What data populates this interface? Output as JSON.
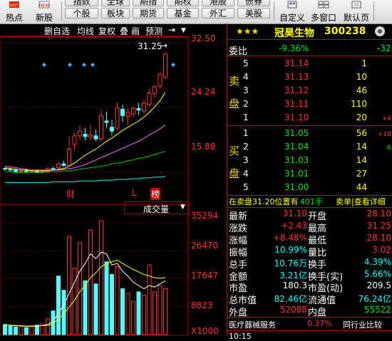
{
  "toolbar": {
    "left_buttons": [
      {
        "label": "热点"
      },
      {
        "label": "新股"
      }
    ],
    "seg_top": [
      "指数",
      "全球",
      "期指",
      "期权",
      "港股",
      "债券"
    ],
    "seg_bottom": [
      "个股",
      "板块",
      "期货",
      "基金",
      "外汇",
      "美股"
    ],
    "right_buttons": [
      {
        "label": "自定义"
      },
      {
        "label": "多窗口"
      },
      {
        "label": "默认页"
      }
    ]
  },
  "kchart": {
    "tabs": [
      "删自选",
      "均线",
      "复权",
      "叠",
      "画",
      "预测"
    ],
    "price_axis": [
      "32.50",
      "24.24",
      "15.88"
    ],
    "high_label": "31.25",
    "event_markers": [
      {
        "label": "财",
        "color": "#ff3232"
      },
      {
        "label": "L",
        "color": "#ff3232"
      },
      {
        "label": "榜",
        "color": "#ffffff",
        "bg": "#c00000"
      }
    ],
    "volume_dropdown": "成交量",
    "volume_axis": [
      "35294",
      "26470",
      "17647",
      "8823",
      "X1000"
    ]
  },
  "chart_data": {
    "type": "candlestick",
    "ylim": [
      14,
      33
    ],
    "candles": [
      {
        "o": 16.4,
        "h": 16.6,
        "l": 16.1,
        "c": 16.3
      },
      {
        "o": 16.3,
        "h": 16.5,
        "l": 16.0,
        "c": 16.2
      },
      {
        "o": 16.2,
        "h": 16.4,
        "l": 15.9,
        "c": 16.0
      },
      {
        "o": 16.0,
        "h": 16.3,
        "l": 15.8,
        "c": 16.1
      },
      {
        "o": 16.1,
        "h": 16.4,
        "l": 15.9,
        "c": 16.0
      },
      {
        "o": 16.0,
        "h": 16.2,
        "l": 15.9,
        "c": 16.1
      },
      {
        "o": 16.1,
        "h": 16.3,
        "l": 15.8,
        "c": 15.9
      },
      {
        "o": 15.9,
        "h": 16.2,
        "l": 15.7,
        "c": 16.0
      },
      {
        "o": 16.0,
        "h": 16.5,
        "l": 15.8,
        "c": 16.4
      },
      {
        "o": 16.4,
        "h": 16.6,
        "l": 16.1,
        "c": 16.2
      },
      {
        "o": 16.5,
        "h": 17.2,
        "l": 16.3,
        "c": 17.0
      },
      {
        "o": 17.0,
        "h": 17.4,
        "l": 16.6,
        "c": 16.8
      },
      {
        "o": 16.8,
        "h": 20.5,
        "l": 16.7,
        "c": 18.9
      },
      {
        "o": 19.5,
        "h": 21.0,
        "l": 18.8,
        "c": 20.6
      },
      {
        "o": 20.6,
        "h": 22.0,
        "l": 20.1,
        "c": 21.2
      },
      {
        "o": 20.8,
        "h": 21.6,
        "l": 20.0,
        "c": 20.5
      },
      {
        "o": 20.4,
        "h": 22.0,
        "l": 20.0,
        "c": 20.7
      },
      {
        "o": 20.6,
        "h": 21.4,
        "l": 19.9,
        "c": 20.2
      },
      {
        "o": 20.2,
        "h": 23.9,
        "l": 19.9,
        "c": 23.2
      },
      {
        "o": 22.5,
        "h": 23.7,
        "l": 21.6,
        "c": 22.3
      },
      {
        "o": 21.7,
        "h": 22.7,
        "l": 20.6,
        "c": 21.2
      },
      {
        "o": 21.6,
        "h": 24.9,
        "l": 21.3,
        "c": 24.2
      },
      {
        "o": 24.0,
        "h": 24.6,
        "l": 22.4,
        "c": 23.2
      },
      {
        "o": 23.1,
        "h": 24.1,
        "l": 22.0,
        "c": 23.6
      },
      {
        "o": 23.4,
        "h": 24.4,
        "l": 23.0,
        "c": 24.1
      },
      {
        "o": 24.1,
        "h": 24.8,
        "l": 23.3,
        "c": 23.9
      },
      {
        "o": 23.8,
        "h": 25.2,
        "l": 23.4,
        "c": 24.8
      },
      {
        "o": 24.6,
        "h": 26.6,
        "l": 24.4,
        "c": 26.1
      },
      {
        "o": 26.0,
        "h": 27.1,
        "l": 25.5,
        "c": 26.9
      },
      {
        "o": 27.0,
        "h": 28.8,
        "l": 26.7,
        "c": 28.5
      },
      {
        "o": 28.1,
        "h": 31.25,
        "l": 28.0,
        "c": 31.1
      }
    ],
    "ma_lines": [
      {
        "color": "#ffff00",
        "values": [
          16.5,
          16.4,
          16.3,
          16.2,
          16.2,
          16.1,
          16.1,
          16.1,
          16.1,
          16.2,
          16.3,
          16.4,
          16.7,
          17.1,
          17.6,
          18.1,
          18.5,
          18.9,
          19.4,
          19.9,
          20.3,
          20.8,
          21.3,
          21.7,
          22.1,
          22.5,
          23.0,
          23.6,
          24.3,
          25.1,
          26.2
        ]
      },
      {
        "color": "#ff66ff",
        "values": [
          16.7,
          16.6,
          16.5,
          16.4,
          16.3,
          16.2,
          16.2,
          16.2,
          16.2,
          16.2,
          16.2,
          16.3,
          16.4,
          16.5,
          16.7,
          16.9,
          17.2,
          17.5,
          17.8,
          18.1,
          18.4,
          18.7,
          19.0,
          19.3,
          19.6,
          19.9,
          20.3,
          20.7,
          21.1,
          21.5,
          22.0
        ]
      },
      {
        "color": "#00d000",
        "values": [
          16.0,
          16.0,
          15.9,
          15.9,
          15.9,
          15.9,
          15.9,
          15.9,
          16.0,
          16.0,
          16.0,
          16.1,
          16.1,
          16.2,
          16.3,
          16.4,
          16.5,
          16.6,
          16.7,
          16.8,
          17.0,
          17.1,
          17.2,
          17.4,
          17.5,
          17.7,
          17.8,
          18.0,
          18.2,
          18.4,
          18.6
        ]
      },
      {
        "color": "#00ffff",
        "values": [
          14.6,
          14.6,
          14.6,
          14.6,
          14.6,
          14.6,
          14.6,
          14.6,
          14.6,
          14.7,
          14.7,
          14.7,
          14.7,
          14.7,
          14.8,
          14.8,
          14.8,
          14.8,
          14.9,
          14.9,
          14.9,
          15.0,
          15.0,
          15.0,
          15.1,
          15.1,
          15.2,
          15.2,
          15.3,
          15.3,
          15.4
        ]
      }
    ],
    "volume": {
      "ylim": [
        0,
        38000
      ],
      "bars": [
        {
          "v": 3200,
          "up": false
        },
        {
          "v": 2600,
          "up": false
        },
        {
          "v": 2400,
          "up": false
        },
        {
          "v": 2800,
          "up": true
        },
        {
          "v": 2200,
          "up": false
        },
        {
          "v": 2500,
          "up": true
        },
        {
          "v": 3000,
          "up": false
        },
        {
          "v": 3300,
          "up": true
        },
        {
          "v": 5000,
          "up": true
        },
        {
          "v": 7500,
          "up": false
        },
        {
          "v": 18500,
          "up": false
        },
        {
          "v": 14000,
          "up": false
        },
        {
          "v": 31000,
          "up": true
        },
        {
          "v": 21000,
          "up": true
        },
        {
          "v": 29000,
          "up": true
        },
        {
          "v": 17000,
          "up": false
        },
        {
          "v": 33000,
          "up": true
        },
        {
          "v": 16000,
          "up": false
        },
        {
          "v": 36000,
          "up": true
        },
        {
          "v": 23000,
          "up": false
        },
        {
          "v": 19000,
          "up": false
        },
        {
          "v": 21500,
          "up": true
        },
        {
          "v": 14500,
          "up": false
        },
        {
          "v": 13000,
          "up": true
        },
        {
          "v": 10500,
          "up": true
        },
        {
          "v": 13500,
          "up": false
        },
        {
          "v": 12500,
          "up": true
        },
        {
          "v": 22000,
          "up": true
        },
        {
          "v": 13500,
          "up": true
        },
        {
          "v": 15500,
          "up": true
        },
        {
          "v": 14500,
          "up": true
        }
      ],
      "ma_lines": [
        {
          "color": "#ffffff",
          "values": [
            3000,
            2900,
            2800,
            2700,
            2600,
            2600,
            2700,
            2800,
            3200,
            4200,
            6800,
            9400,
            13000,
            16500,
            20000,
            22500,
            25500,
            24000,
            26000,
            25500,
            22000,
            22500,
            20000,
            18500,
            16500,
            15500,
            14500,
            15500,
            15000,
            16000,
            17000
          ]
        },
        {
          "color": "#ffff00",
          "values": [
            3100,
            3000,
            2900,
            2800,
            2700,
            2700,
            2800,
            2800,
            2900,
            3400,
            5000,
            6500,
            8700,
            10800,
            13500,
            15500,
            18000,
            19500,
            21500,
            22500,
            23000,
            23500,
            22500,
            21500,
            20500,
            19800,
            19000,
            18500,
            18000,
            17800,
            18000
          ]
        }
      ]
    }
  },
  "quote": {
    "stars": "★★★",
    "name": "冠昊生物",
    "code": "300238",
    "webi_label": "委比",
    "webi_value": "-9.36%",
    "webi_diff": "-32",
    "sell_label": [
      "卖",
      "盘"
    ],
    "buy_label": [
      "买",
      "盘"
    ],
    "asks": [
      {
        "lvl": "5",
        "price": "31.14",
        "vol": "1",
        "chg": ""
      },
      {
        "lvl": "4",
        "price": "31.13",
        "vol": "10",
        "chg": ""
      },
      {
        "lvl": "3",
        "price": "31.12",
        "vol": "46",
        "chg": ""
      },
      {
        "lvl": "2",
        "price": "31.11",
        "vol": "110",
        "chg": ""
      },
      {
        "lvl": "1",
        "price": "31.10",
        "vol": "20",
        "chg": "+4"
      }
    ],
    "bids": [
      {
        "lvl": "1",
        "price": "31.05",
        "vol": "56",
        "chg": "+18"
      },
      {
        "lvl": "2",
        "price": "31.04",
        "vol": "14",
        "chg": "-6"
      },
      {
        "lvl": "3",
        "price": "31.03",
        "vol": "14",
        "chg": ""
      },
      {
        "lvl": "4",
        "price": "31.01",
        "vol": "27",
        "chg": ""
      },
      {
        "lvl": "5",
        "price": "31.00",
        "vol": "44",
        "chg": ""
      }
    ],
    "info_bar": {
      "text": "在卖盘31.20位置有",
      "count": "401手",
      "action": "卖单|查看详细"
    },
    "stats": [
      {
        "l1": "最新",
        "v1": "31.10",
        "c1": "red",
        "l2": "开盘",
        "v2": "28.10",
        "c2": "red"
      },
      {
        "l1": "涨跌",
        "v1": "+2.43",
        "c1": "red",
        "l2": "最高",
        "v2": "31.25",
        "c2": "red"
      },
      {
        "l1": "涨幅",
        "v1": "+8.48%",
        "c1": "red",
        "l2": "最低",
        "v2": "28.10",
        "c2": "red"
      },
      {
        "l1": "振幅",
        "v1": "10.99%",
        "c1": "cyan",
        "l2": "量比",
        "v2": "3.02",
        "c2": "red"
      },
      {
        "l1": "总手",
        "v1": "10.76万",
        "c1": "cyan",
        "l2": "换手",
        "v2": "4.39%",
        "c2": "cyan"
      },
      {
        "l1": "金额",
        "v1": "3.21亿",
        "c1": "cyan",
        "l2": "换手(实)",
        "v2": "5.66%",
        "c2": "cyan"
      },
      {
        "l1": "市盈",
        "v1": "180.3",
        "c1": "wht",
        "l2": "市盈(动)",
        "v2": "209.5",
        "c2": "wht"
      },
      {
        "l1": "总市值",
        "v1": "82.46亿",
        "c1": "cyan",
        "l2": "流通值",
        "v2": "76.24亿",
        "c2": "cyan"
      },
      {
        "l1": "外盘",
        "v1": "52088",
        "c1": "red",
        "l2": "内盘",
        "v2": "55522",
        "c2": "grn"
      }
    ],
    "footer": {
      "industry": "医疗器械服务",
      "pct": "0.37%",
      "link": "同行业比较",
      "time": "10:15"
    }
  }
}
